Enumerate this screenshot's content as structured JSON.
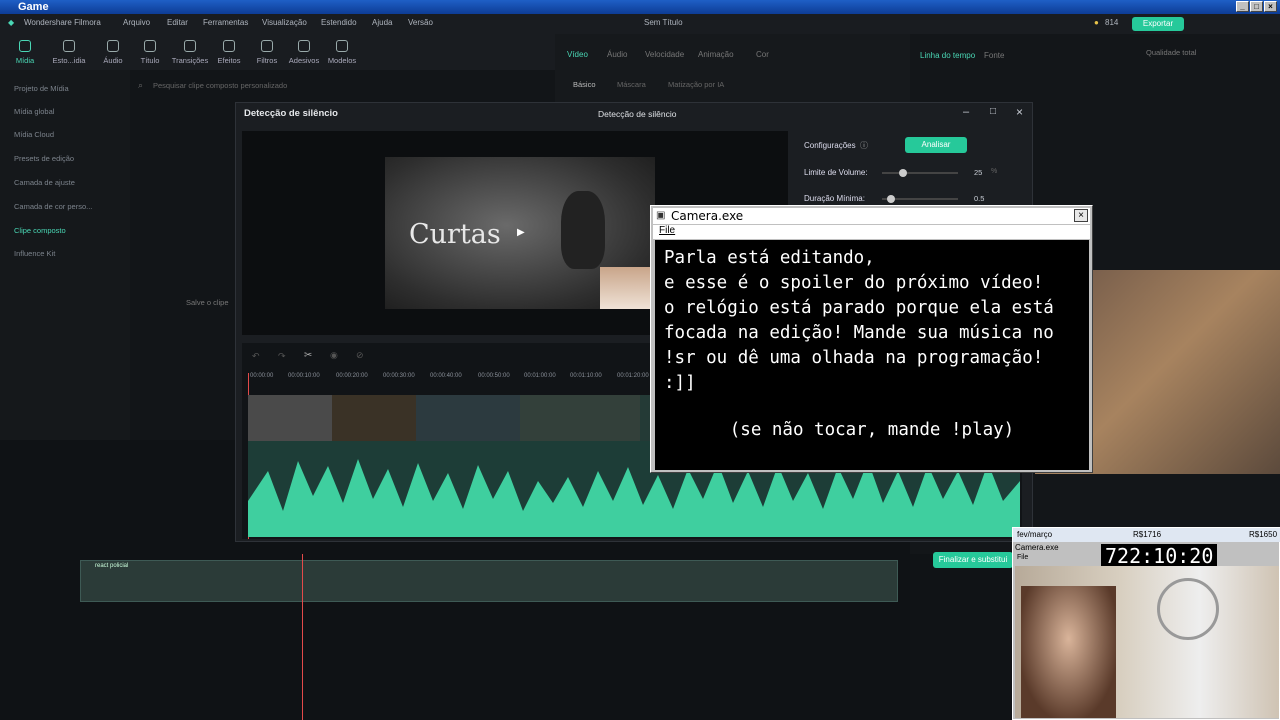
{
  "game_bar": {
    "title": "Game"
  },
  "filmora": {
    "app_name": "Wondershare Filmora",
    "menu": [
      "Arquivo",
      "Editar",
      "Ferramentas",
      "Visualização",
      "Estendido",
      "Ajuda",
      "Versão"
    ],
    "doc_title": "Sem Título",
    "coins": "814",
    "export_label": "Exportar",
    "toolbar": [
      "Mídia",
      "Esto...idia",
      "Áudio",
      "Título",
      "Transições",
      "Efeitos",
      "Filtros",
      "Adesivos",
      "Modelos"
    ],
    "left_nav": [
      "Projeto de Mídia",
      "Mídia global",
      "Mídia Cloud",
      "Presets de edição",
      "Camada de ajuste",
      "Camada de cor perso...",
      "Clipe composto",
      "Influence Kit"
    ],
    "search_placeholder": "Pesquisar clipe composto personalizado",
    "save_hint": "Salve o clipe",
    "prop_tabs": [
      "Vídeo",
      "Áudio",
      "Velocidade",
      "Animação",
      "Cor"
    ],
    "prop_subtabs": [
      "Básico",
      "Máscara",
      "Matização por IA"
    ],
    "right_tabs": [
      "Linha do tempo",
      "Fonte"
    ],
    "quality": "Qualidade total",
    "track_label": "react policial"
  },
  "silence_dialog": {
    "title": "Detecção de silêncio",
    "center_title": "Detecção de silêncio",
    "config_label": "Configurações",
    "analyze_label": "Analisar",
    "volume_label": "Limite de Volume:",
    "volume_value": "25",
    "volume_unit": "%",
    "duration_label": "Duração Mínima:",
    "duration_value": "0.5",
    "preview_text": "Curtas",
    "finish_label": "Finalizar e substitui",
    "ruler": [
      "00:00:00",
      "00:00:10:00",
      "00:00:20:00",
      "00:00:30:00",
      "00:00:40:00",
      "00:00:50:00",
      "00:01:00:00",
      "00:01:10:00",
      "00:01:20:00"
    ]
  },
  "camera_window": {
    "title": "Camera.exe",
    "menu_file": "File",
    "message": "Parla está editando,\ne esse é o spoiler do próximo vídeo!\no relógio está parado porque ela está\nfocada na edição! Mande sua música no\n!sr ou dê uma olhada na programação!\n:]]",
    "play_hint": "(se não tocar, mande !play)"
  },
  "webcam_widget": {
    "header": "fev/março",
    "amount_left": "R$1716",
    "amount_right": "R$1650",
    "window_title": "Camera.exe",
    "menu": "File",
    "clock": "722:10:20"
  },
  "colors": {
    "accent": "#26c99a",
    "panel": "#1b1e22"
  }
}
